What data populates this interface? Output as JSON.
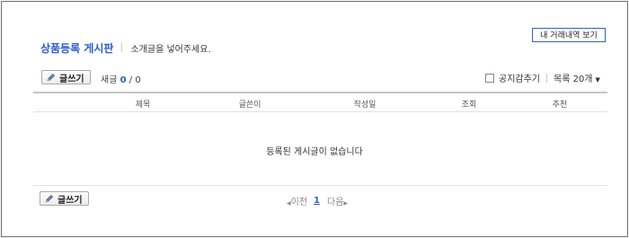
{
  "header": {
    "my_trade_label": "내 거래내역 보기",
    "board_title": "상품등록 게시판",
    "board_desc": "소개글을 넣어주세요."
  },
  "toolbar": {
    "write_label": "글쓰기",
    "new_posts_label": "새글",
    "new_posts_count": "0",
    "separator": "/",
    "total_posts": "0",
    "notice_hide_label": "공지감추기",
    "list_size_label": "목록 20개",
    "list_size_caret": "▼"
  },
  "table": {
    "columns": [
      "제목",
      "글쓴이",
      "작성일",
      "조회",
      "추천"
    ],
    "empty_message": "등록된 게시글이 없습니다"
  },
  "footer": {
    "write_label": "글쓰기",
    "pager": {
      "prev_arrow": "◀",
      "prev_label": "이전",
      "current_page": "1",
      "next_label": "다음",
      "next_arrow": "▶"
    }
  },
  "colors": {
    "accent": "#2f5bd0",
    "button_border": "#2f63c9",
    "frame_border": "#6f6f6f"
  },
  "icons": {
    "write": "pencil-icon",
    "checkbox": "checkbox-icon",
    "dropdown": "caret-down-icon"
  }
}
